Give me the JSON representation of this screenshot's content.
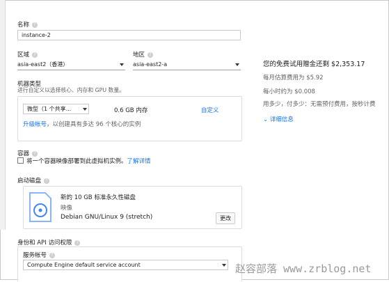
{
  "name_field": {
    "label": "名称",
    "value": "instance-2"
  },
  "region": {
    "label": "区域",
    "value": "asia-east2（香港）"
  },
  "zone": {
    "label": "地区",
    "value": "asia-east2-a"
  },
  "machine": {
    "title": "机器类型",
    "subtitle": "进行自定义以选择核心、内存和 GPU 数量。",
    "cores_select": "微型（1 个共享...",
    "memory": "0.6 GB 内存",
    "customize": "自定义",
    "upgrade_link": "升级帐号",
    "upgrade_text": "，以创建具有多达 96 个核心的实例"
  },
  "container": {
    "title": "容器",
    "checkbox_text": "将一个容器映像部署到此虚拟机实例。",
    "learn_more": "了解详情"
  },
  "boot_disk": {
    "title": "启动磁盘",
    "disk_title": "新的 10 GB 标准永久性磁盘",
    "image_label": "映像",
    "os": "Debian GNU/Linux 9 (stretch)",
    "change_button": "更改"
  },
  "identity": {
    "title": "身份和 API 访问权限",
    "service_account_label": "服务帐号",
    "service_account_value": "Compute Engine default service account"
  },
  "pricing": {
    "free_trial": "您的免费试用赠金还剩 $2,353.17",
    "monthly": "每月估算费用为 $5.92",
    "hourly": "每小时约为 $0.008",
    "usage": "用多少，付多少：无需预付费用，按秒计费",
    "details": "详细信息"
  },
  "watermark": "赵容部落 www.zrblog.net"
}
